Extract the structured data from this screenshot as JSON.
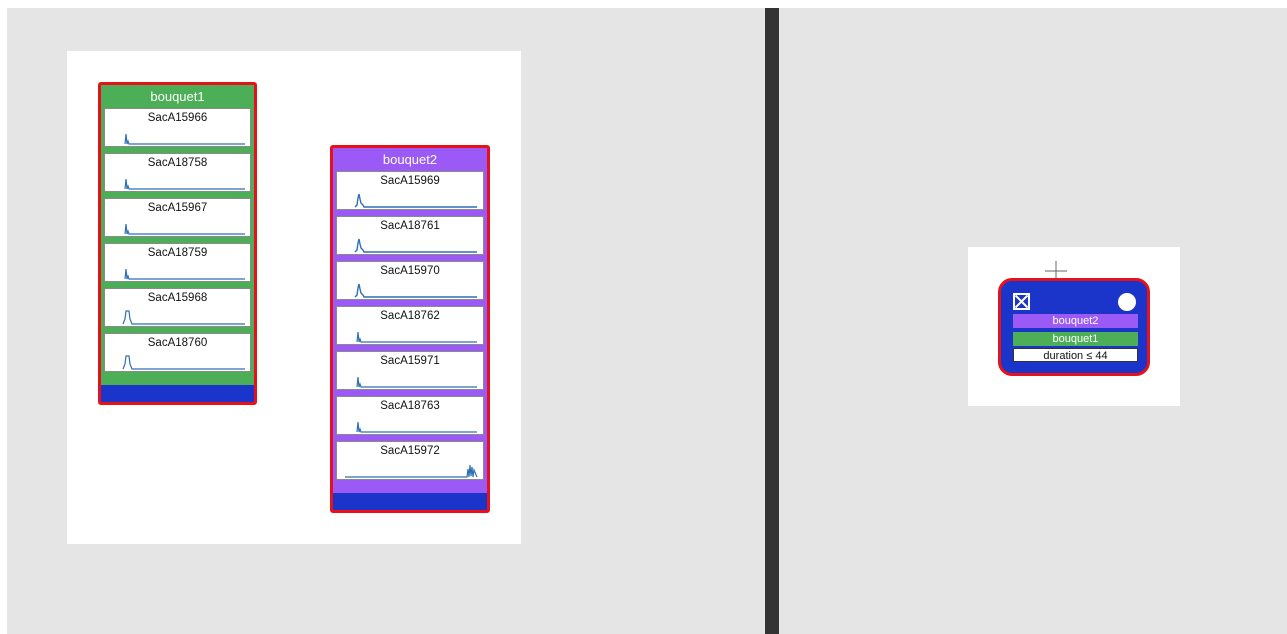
{
  "left": {
    "bouquets": [
      {
        "title": "bouquet1",
        "color": "#4caf57",
        "samples": [
          {
            "name": "SacA15966",
            "glyph": "thin-spike"
          },
          {
            "name": "SacA18758",
            "glyph": "thin-spike"
          },
          {
            "name": "SacA15967",
            "glyph": "thin-spike"
          },
          {
            "name": "SacA18759",
            "glyph": "thin-spike"
          },
          {
            "name": "SacA15968",
            "glyph": "wide-peak"
          },
          {
            "name": "SacA18760",
            "glyph": "wide-peak"
          }
        ]
      },
      {
        "title": "bouquet2",
        "color": "#9b59f5",
        "samples": [
          {
            "name": "SacA15969",
            "glyph": "double-peak"
          },
          {
            "name": "SacA18761",
            "glyph": "double-peak"
          },
          {
            "name": "SacA15970",
            "glyph": "double-peak"
          },
          {
            "name": "SacA18762",
            "glyph": "thin-spike"
          },
          {
            "name": "SacA15971",
            "glyph": "thin-spike"
          },
          {
            "name": "SacA18763",
            "glyph": "thin-spike"
          },
          {
            "name": "SacA15972",
            "glyph": "right-cluster"
          }
        ]
      }
    ]
  },
  "right": {
    "node": {
      "rows": [
        {
          "label": "bouquet2",
          "bg": "#9b59f5",
          "fg": "#ffffff"
        },
        {
          "label": "bouquet1",
          "bg": "#4caf57",
          "fg": "#ffffff"
        },
        {
          "label": "duration ≤ 44",
          "bg": "#ffffff",
          "fg": "#111111"
        }
      ]
    }
  },
  "colors": {
    "selection": "#e8111a",
    "footer": "#1b34c9",
    "spark": "#2f6fb5"
  }
}
